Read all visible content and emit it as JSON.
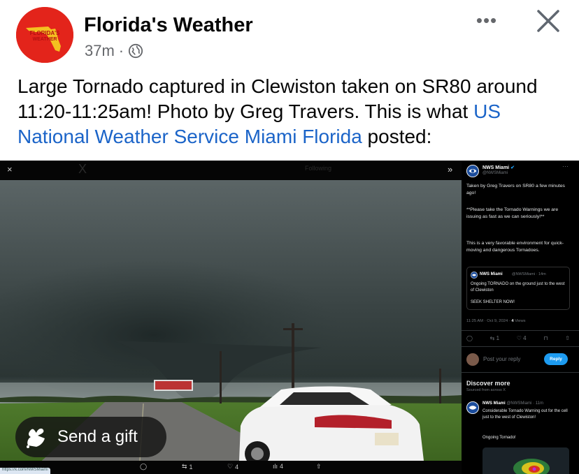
{
  "post": {
    "page_name": "Florida's Weather",
    "timestamp": "37m",
    "separator": "·",
    "avatar_text_line1": "FLORIDA'S",
    "avatar_text_line2": "WEATHER",
    "caption_text": "Large Tornado captured in Clewiston taken on SR80 around 11:20-11:25am! Photo by Greg Travers. This is what ",
    "caption_link": "US National Weather Service Miami Florida",
    "caption_end": " posted:",
    "more_label": "•••",
    "icons": {
      "privacy": "globe-icon",
      "close": "close-icon",
      "more": "more-options-icon"
    }
  },
  "viewer": {
    "close_label": "×",
    "faint_close": "X",
    "following_label": "Following",
    "next_label": "»",
    "bar": {
      "reply_count": "",
      "retweet_count": "1",
      "like_count": "4",
      "view_count": "4"
    },
    "url_chip": "https://x.com/NWSMiami",
    "gift_label": "Send a gift"
  },
  "sidebar": {
    "name": "NWS Miami",
    "handle": "@NWSMiami",
    "more": "···",
    "tweet_lines": [
      "Taken by Greg Travers on SR80 a few minutes ago!",
      "**Please take the Tornado Warnings we are issuing as fast as we can seriously!**",
      "This is a very favorable environment for quick-moving and dangerous Tornadoes."
    ],
    "quote": {
      "name": "NWS Miami",
      "handle": "@NWSMiami · 14m",
      "line1": "Ongoing TORNADO on the ground just to the west of Clewiston",
      "line2": "SEEK SHELTER NOW!"
    },
    "time": "11:25 AM · Oct 9, 2024 · ",
    "views": "4",
    "views_label": "Views",
    "actions": {
      "reply": "",
      "retweet": "1",
      "like": "4"
    },
    "reply_placeholder": "Post your reply",
    "reply_button": "Reply",
    "discover_title": "Discover more",
    "discover_sub": "Sourced from across X",
    "discover_post": {
      "name": "NWS Miami",
      "handle": "@NWSMiami · 11m",
      "text": "Considerable Tornado Warning out for the cell just to the west of Clewiston!",
      "text2": "Ongoing Tornado!"
    }
  },
  "colors": {
    "link": "#1b64c8",
    "reply_button": "#1d9bf0",
    "avatar_red": "#e3241b"
  }
}
